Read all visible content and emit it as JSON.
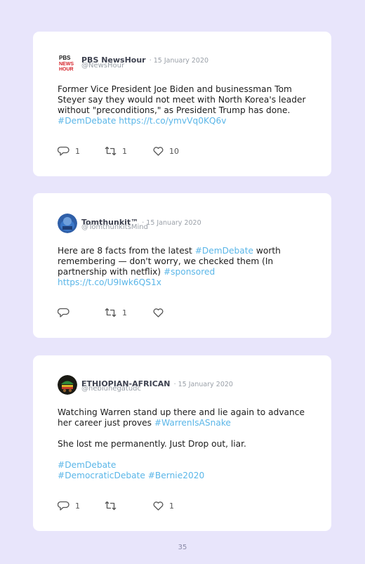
{
  "page_number": "35",
  "tweets": [
    {
      "name": "PBS NewsHour",
      "date": "· 15 January 2020",
      "handle": "@NewsHour",
      "logo": "PBS NEWS HOUR",
      "text": {
        "l1": "Former Vice President Joe Biden and businessman Tom",
        "l2": "Steyer say they would not meet with North Korea's leader",
        "l3": "without \"preconditions,\" as President Trump has done.",
        "l4a": "#DemDebate",
        "l4b": "https://t.co/ymvVq0KQ6v"
      },
      "replies": "1",
      "retweets": "1",
      "likes": "10"
    },
    {
      "name": "Tomthunkit™",
      "date": "· 15 January 2020",
      "handle": "@TomthunkitsMind",
      "text": {
        "l1a": "Here are 8 facts from the latest ",
        "l1b": "#DemDebate",
        "l1c": " worth",
        "l2": "remembering — don't worry, we checked them (In",
        "l3a": "partnership with netflix) ",
        "l3b": "#sponsored",
        "l4": "https://t.co/U9Iwk6QS1x"
      },
      "replies": "",
      "retweets": "1",
      "likes": ""
    },
    {
      "name": "ETHIOPIAN-AFRICAN",
      "date": "· 15 January 2020",
      "handle": "@nebiunegatudc",
      "text": {
        "l1": "Watching Warren stand up there and lie again to advance",
        "l2a": "her career just proves ",
        "l2b": "#WarrenIsASnake",
        "l3": "She lost me permanently. Just Drop out, liar.",
        "l4": "#DemDebate",
        "l5a": "#DemocraticDebate",
        "l5b": "#Bernie2020"
      },
      "replies": "1",
      "retweets": "",
      "likes": "1"
    }
  ],
  "colors": {
    "page_bg": "#e8e5fb",
    "card_bg": "#ffffff",
    "hashtag": "#5ab6e8",
    "meta_gray": "#9aa0a8",
    "pbs_red": "#d41f26"
  },
  "icons": [
    "reply-icon",
    "retweet-icon",
    "like-icon"
  ]
}
